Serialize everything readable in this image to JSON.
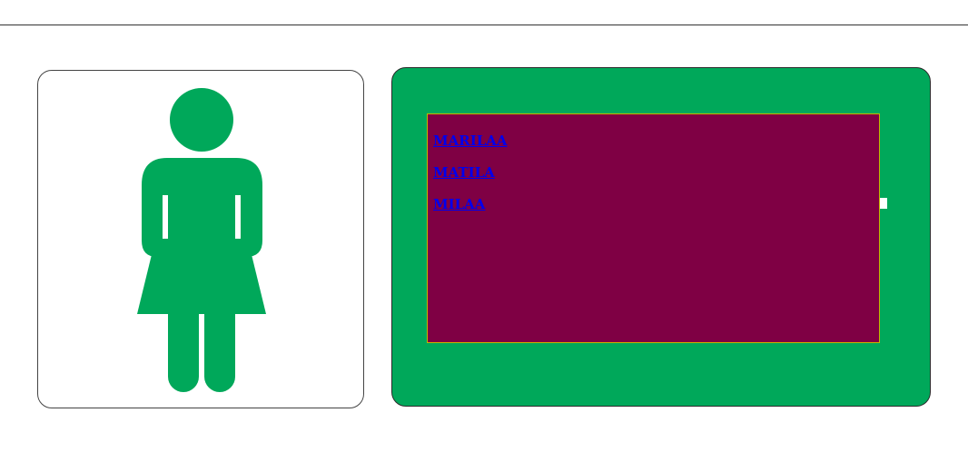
{
  "colors": {
    "brand_green": "#00a85a",
    "inner_box": "#7f0044",
    "link": "#0000ee",
    "card_border": "#444444"
  },
  "figure_card": {
    "icon": "woman-restroom-icon"
  },
  "links": [
    {
      "label": "MARILAA"
    },
    {
      "label": "MATILA"
    },
    {
      "label": "MILAA"
    }
  ]
}
